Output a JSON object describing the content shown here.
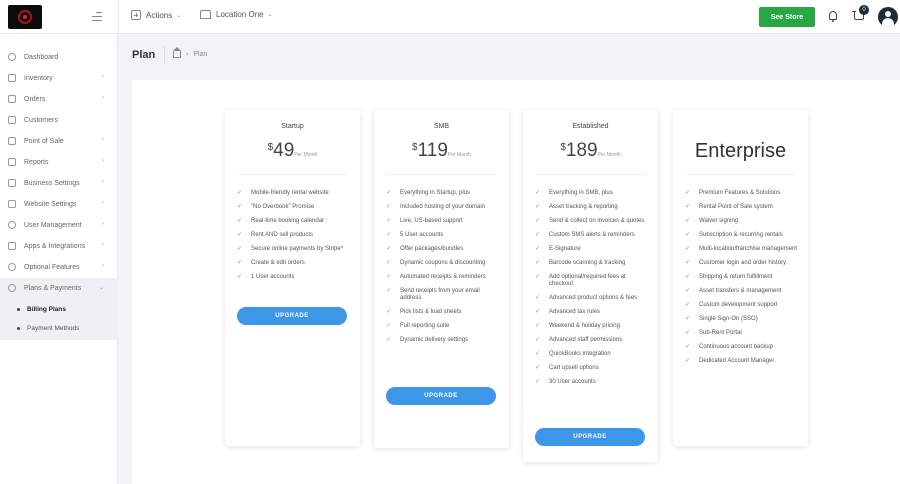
{
  "header": {
    "actions_label": "Actions",
    "location_label": "Location One",
    "see_store_label": "See Store",
    "cart_count": "0"
  },
  "sidebar": {
    "items": [
      {
        "label": "Dashboard",
        "icon": "dashboard-icon"
      },
      {
        "label": "Inventory",
        "icon": "inventory-icon"
      },
      {
        "label": "Orders",
        "icon": "orders-icon"
      },
      {
        "label": "Customers",
        "icon": "customers-icon"
      },
      {
        "label": "Point of Sale",
        "icon": "point-of-sale-icon"
      },
      {
        "label": "Reports",
        "icon": "reports-icon"
      },
      {
        "label": "Business Settings",
        "icon": "business-settings-icon"
      },
      {
        "label": "Website Settings",
        "icon": "website-settings-icon"
      },
      {
        "label": "User Management",
        "icon": "user-management-icon"
      },
      {
        "label": "Apps & Integrations",
        "icon": "apps-icon"
      },
      {
        "label": "Optional Features",
        "icon": "optional-features-icon"
      },
      {
        "label": "Plans & Payments",
        "icon": "star-icon"
      }
    ],
    "sub_items": [
      {
        "label": "Billing Plans",
        "active": true
      },
      {
        "label": "Payment Methods",
        "active": false
      }
    ]
  },
  "page": {
    "title": "Plan",
    "breadcrumb": "Plan"
  },
  "plans": [
    {
      "name": "Startup",
      "currency": "$",
      "price": "49",
      "period": "Per Month",
      "upgrade_label": "UPGRADE",
      "features": [
        "Mobile-friendly rental website",
        "\"No Overbook\" Promise",
        "Real-time booking calendar",
        "Rent AND sell products",
        "Secure online payments by Stripe*",
        "Create & edit orders",
        "1 User accounts"
      ]
    },
    {
      "name": "SMB",
      "currency": "$",
      "price": "119",
      "period": "Per Month",
      "upgrade_label": "UPGRADE",
      "features": [
        "Everything in Startup, plus",
        "Included hosting of your domain",
        "Live, US-based support",
        "5 User accounts",
        "Offer packages/bundles",
        "Dynamic coupons & discounting",
        "Automated receipts & reminders",
        "Send receipts from your email address",
        "Pick lists & load sheets",
        "Full reporting suite",
        "Dynamic delivery settings"
      ]
    },
    {
      "name": "Established",
      "currency": "$",
      "price": "189",
      "period": "Per Month",
      "upgrade_label": "UPGRADE",
      "features": [
        "Everything in SMB, plus",
        "Asset tracking & reporting",
        "Send & collect on invoices & quotes",
        "Custom SMS alerts & reminders",
        "E-Signature",
        "Barcode scanning & tracking",
        "Add optional/required fees at checkout",
        "Advanced product options & fees",
        "Advanced tax rules",
        "Weekend & holiday pricing",
        "Advanced staff permissions",
        "QuickBooks integration",
        "Cart upsell options",
        "30 User accounts"
      ]
    },
    {
      "name": "Enterprise",
      "features": [
        "Premium Features & Solutions",
        "Rental Point of Sale system",
        "Waiver signing",
        "Subscription & recurring rentals",
        "Multi-location/franchise management",
        "Customer login and order history",
        "Shipping & return fulfillment",
        "Asset transfers & management",
        "Custom development support",
        "Single Sign-On (SSO)",
        "Sub-Rent Portal",
        "Continuous account backup",
        "Dedicated Account Manager"
      ]
    }
  ]
}
